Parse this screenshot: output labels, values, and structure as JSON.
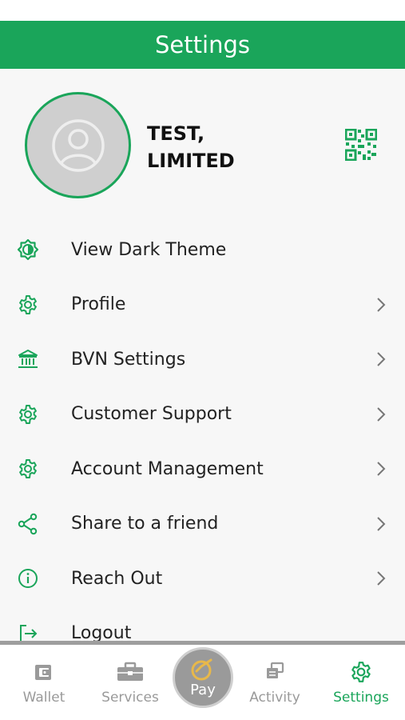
{
  "header": {
    "title": "Settings"
  },
  "profile": {
    "name": "TEST, LIMITED"
  },
  "menu": {
    "items": [
      {
        "label": "View Dark Theme",
        "icon": "theme-toggle-icon",
        "chevron": false
      },
      {
        "label": "Profile",
        "icon": "gear-icon",
        "chevron": true
      },
      {
        "label": "BVN Settings",
        "icon": "bank-icon",
        "chevron": true
      },
      {
        "label": "Customer Support",
        "icon": "gear-icon",
        "chevron": true
      },
      {
        "label": "Account Management",
        "icon": "gear-icon",
        "chevron": true
      },
      {
        "label": "Share to a friend",
        "icon": "share-icon",
        "chevron": true
      },
      {
        "label": "Reach Out",
        "icon": "info-icon",
        "chevron": true
      },
      {
        "label": "Logout",
        "icon": "logout-icon",
        "chevron": false
      }
    ]
  },
  "bottom_nav": {
    "wallet": "Wallet",
    "services": "Services",
    "pay": "Pay",
    "activity": "Activity",
    "settings": "Settings"
  },
  "colors": {
    "accent": "#1aa55a",
    "inactive": "#9a9a9a",
    "pay_ring": "#e8b84a"
  }
}
